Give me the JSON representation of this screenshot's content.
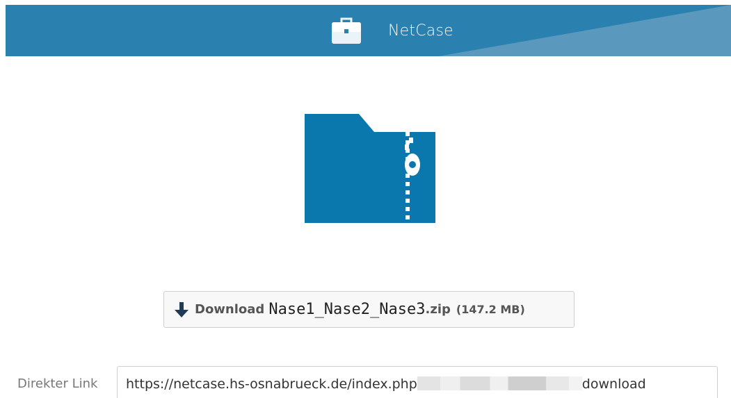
{
  "header": {
    "app_name": "NetCase",
    "logo_icon": "briefcase-icon",
    "colors": {
      "bar": "#2a80ae",
      "accent": "#5a98bd"
    }
  },
  "file": {
    "icon": "zip-folder-icon",
    "icon_color": "#0b78ad"
  },
  "download_button": {
    "icon": "download-arrow-icon",
    "label": "Download",
    "file_name": "Nase1_Nase2_Nase3",
    "extension": ".zip",
    "size": "(147.2 MB)"
  },
  "direct_link": {
    "label": "Direkter Link",
    "url_prefix": "https://netcase.hs-osnabrueck.de/index.php",
    "url_suffix": "download"
  }
}
